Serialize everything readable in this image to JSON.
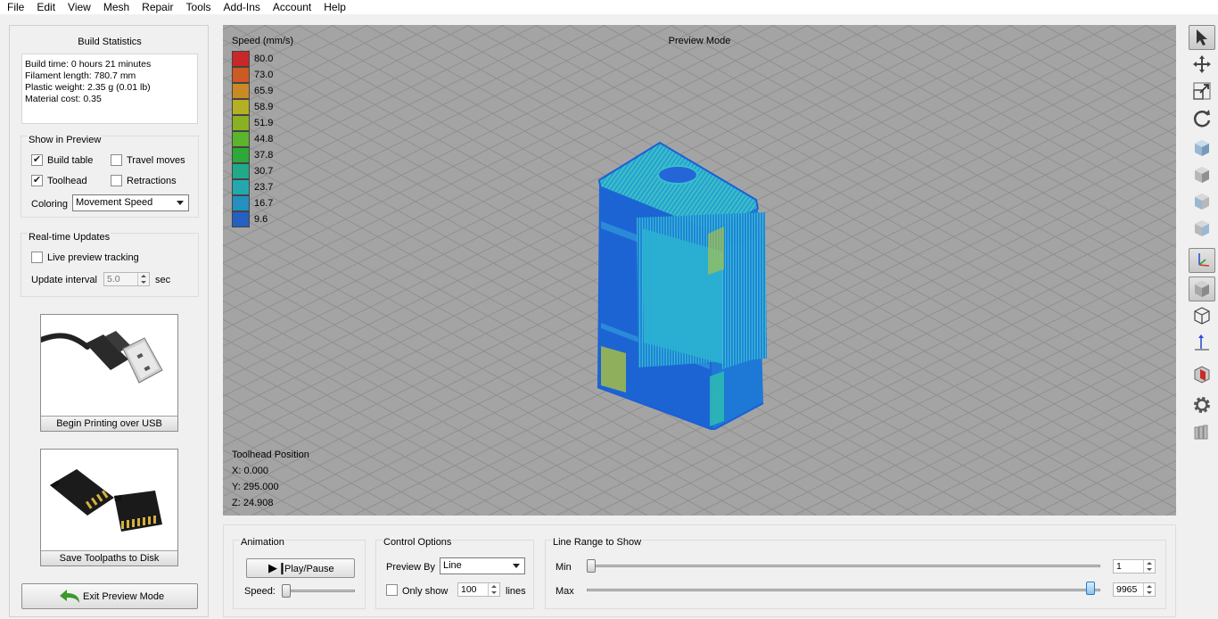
{
  "menu": [
    "File",
    "Edit",
    "View",
    "Mesh",
    "Repair",
    "Tools",
    "Add-Ins",
    "Account",
    "Help"
  ],
  "stats": {
    "title": "Build Statistics",
    "lines": [
      "Build time: 0 hours 21 minutes",
      "Filament length: 780.7 mm",
      "Plastic weight: 2.35 g (0.01 lb)",
      "Material cost: 0.35"
    ]
  },
  "show": {
    "title": "Show in Preview",
    "build_table": "Build table",
    "build_table_checked": true,
    "travel": "Travel moves",
    "travel_checked": false,
    "toolhead": "Toolhead",
    "toolhead_checked": true,
    "retractions": "Retractions",
    "retractions_checked": false,
    "coloring_label": "Coloring",
    "coloring_value": "Movement Speed"
  },
  "realtime": {
    "title": "Real-time Updates",
    "live": "Live preview tracking",
    "live_checked": false,
    "interval_label": "Update interval",
    "interval_value": "5.0",
    "interval_unit": "sec"
  },
  "usb_button": "Begin Printing over USB",
  "sd_button": "Save Toolpaths to Disk",
  "exit_button": "Exit Preview Mode",
  "viewport": {
    "mode": "Preview Mode",
    "legend_title": "Speed (mm/s)",
    "legend": [
      {
        "v": "80.0",
        "c": "#c8282a"
      },
      {
        "v": "73.0",
        "c": "#cc5a22"
      },
      {
        "v": "65.9",
        "c": "#c88a26"
      },
      {
        "v": "58.9",
        "c": "#b4b024"
      },
      {
        "v": "51.9",
        "c": "#8cb024"
      },
      {
        "v": "44.8",
        "c": "#5ab42c"
      },
      {
        "v": "37.8",
        "c": "#2ea838"
      },
      {
        "v": "30.7",
        "c": "#22a88a"
      },
      {
        "v": "23.7",
        "c": "#24a8b0"
      },
      {
        "v": "16.7",
        "c": "#2490c0"
      },
      {
        "v": "9.6",
        "c": "#2460c0"
      }
    ],
    "pos_title": "Toolhead Position",
    "x": "X: 0.000",
    "y": "Y: 295.000",
    "z": "Z: 24.908"
  },
  "animation": {
    "title": "Animation",
    "play": "Play/Pause",
    "speed": "Speed:"
  },
  "control": {
    "title": "Control Options",
    "preview_by": "Preview By",
    "preview_value": "Line",
    "only_show": "Only show",
    "only_checked": false,
    "count": "100",
    "lines": "lines"
  },
  "range": {
    "title": "Line Range to Show",
    "min": "Min",
    "max": "Max",
    "min_value": "1",
    "max_value": "9965",
    "min_fraction": 0.0,
    "max_fraction": 1.0
  },
  "toolbar": [
    "pointer-icon",
    "move-icon",
    "scale-icon",
    "rotate-icon",
    "cube-view-1-icon",
    "cube-view-2-icon",
    "cube-view-3-icon",
    "cube-view-4-icon",
    "axes-icon",
    "solid-view-icon",
    "wireframe-view-icon",
    "axis-z-icon",
    "section-view-icon",
    "settings-gear-icon",
    "stack-icon"
  ]
}
